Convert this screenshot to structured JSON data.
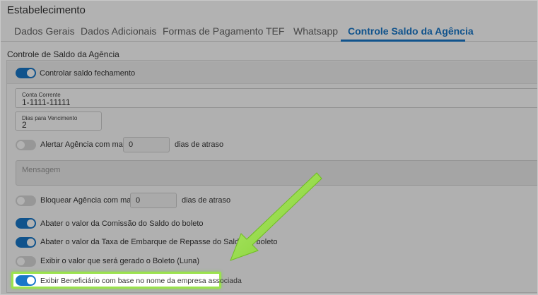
{
  "window": {
    "title": "Estabelecimento"
  },
  "tabs": [
    {
      "label": "Dados Gerais"
    },
    {
      "label": "Dados Adicionais"
    },
    {
      "label": "Formas de Pagamento"
    },
    {
      "label": "TEF"
    },
    {
      "label": "Whatsapp"
    },
    {
      "label": "Controle Saldo da Agência",
      "active": true
    }
  ],
  "section": {
    "title": "Controle de Saldo da Agência"
  },
  "form": {
    "controlar_saldo": {
      "label": "Controlar saldo fechamento",
      "checked": true
    },
    "conta_corrente": {
      "label": "Conta Corrente",
      "value": "1-1111-11111"
    },
    "dias_vencimento": {
      "label": "Dias para Vencimento",
      "value": "2"
    },
    "alertar": {
      "label": "Alertar Agência com mais de",
      "value": "0",
      "suffix": "dias de atraso",
      "checked": false
    },
    "mensagem": {
      "placeholder": "Mensagem"
    },
    "bloquear": {
      "label": "Bloquear Agência com mais de",
      "value": "0",
      "suffix": "dias de atraso",
      "checked": false
    },
    "abater_comissao": {
      "label": "Abater o valor da Comissão do Saldo do boleto",
      "checked": true
    },
    "abater_taxa": {
      "label": "Abater o valor da Taxa de Embarque de Repasse do Saldo do boleto",
      "checked": true
    },
    "exibir_valor": {
      "label": "Exibir o valor que será gerado o Boleto (Luna)",
      "checked": false
    },
    "exibir_beneficiario": {
      "label": "Exibir Beneficiário com base no nome da empresa associada",
      "checked": true
    }
  },
  "colors": {
    "accent": "#1877c9",
    "highlight": "#9be24e",
    "arrow": "#8fd63a"
  }
}
